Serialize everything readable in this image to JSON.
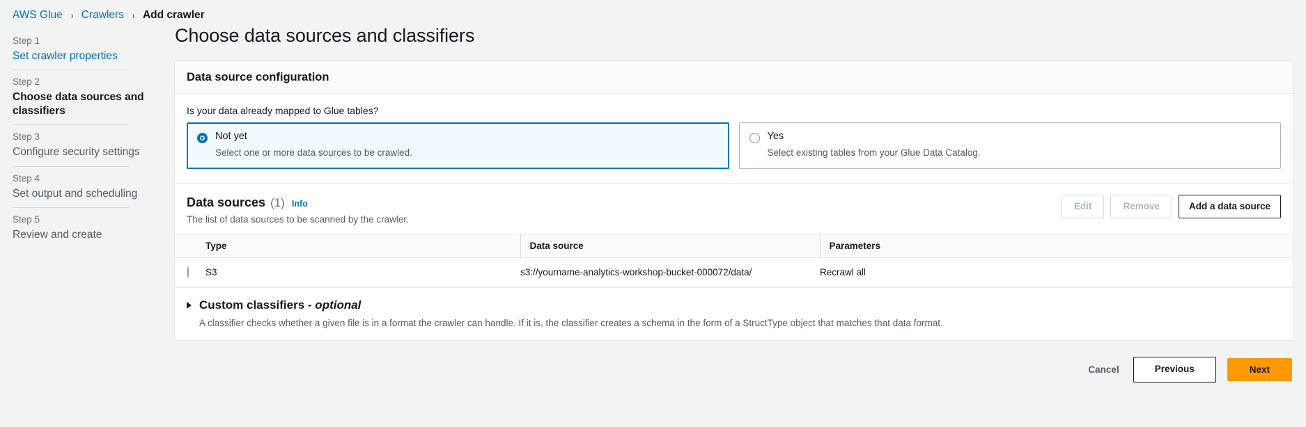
{
  "breadcrumb": {
    "items": [
      {
        "label": "AWS Glue",
        "current": false
      },
      {
        "label": "Crawlers",
        "current": false
      },
      {
        "label": "Add crawler",
        "current": true
      }
    ],
    "separator": "›"
  },
  "steps": [
    {
      "step": "Step 1",
      "title": "Set crawler properties",
      "state": "link"
    },
    {
      "step": "Step 2",
      "title": "Choose data sources and classifiers",
      "state": "active"
    },
    {
      "step": "Step 3",
      "title": "Configure security settings",
      "state": "inactive"
    },
    {
      "step": "Step 4",
      "title": "Set output and scheduling",
      "state": "inactive"
    },
    {
      "step": "Step 5",
      "title": "Review and create",
      "state": "inactive"
    }
  ],
  "page": {
    "title": "Choose data sources and classifiers"
  },
  "panel": {
    "title": "Data source configuration",
    "question": "Is your data already mapped to Glue tables?",
    "options": [
      {
        "label": "Not yet",
        "description": "Select one or more data sources to be crawled.",
        "selected": true
      },
      {
        "label": "Yes",
        "description": "Select existing tables from your Glue Data Catalog.",
        "selected": false
      }
    ]
  },
  "data_sources": {
    "title": "Data sources",
    "count": "(1)",
    "info_label": "Info",
    "subtitle": "The list of data sources to be scanned by the crawler.",
    "actions": {
      "edit": "Edit",
      "remove": "Remove",
      "add": "Add a data source"
    },
    "columns": [
      "Type",
      "Data source",
      "Parameters"
    ],
    "rows": [
      {
        "type": "S3",
        "data_source": "s3://yourname-analytics-workshop-bucket-000072/data/",
        "parameters": "Recrawl all"
      }
    ]
  },
  "custom_classifiers": {
    "title": "Custom classifiers",
    "optional_suffix": "- optional",
    "description": "A classifier checks whether a given file is in a format the crawler can handle. If it is, the classifier creates a schema in the form of a StructType object that matches that data format.",
    "expanded": false
  },
  "footer": {
    "cancel": "Cancel",
    "previous": "Previous",
    "next": "Next"
  },
  "colors": {
    "link": "#0073bb",
    "accent_orange": "#ff9900",
    "page_bg": "#f2f3f3",
    "selected_tile_bg": "#f1faff"
  }
}
